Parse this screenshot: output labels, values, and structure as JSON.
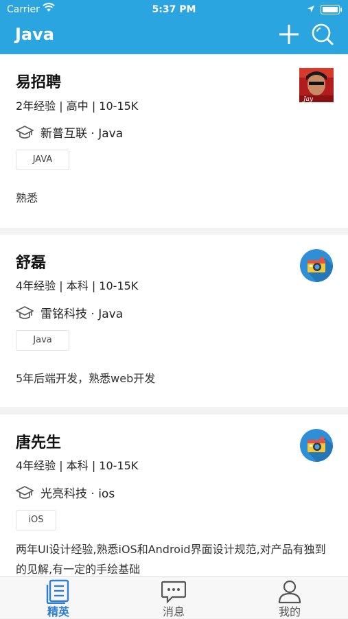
{
  "status": {
    "carrier": "Carrier",
    "time": "5:37 PM"
  },
  "nav": {
    "title": "Java"
  },
  "candidates": [
    {
      "name": "易招聘",
      "meta": "2年经验 | 高中 | 10-15K",
      "company": "新普互联 · Java",
      "tag": "JAVA",
      "desc": "熟悉",
      "avatar": "photo-avatar"
    },
    {
      "name": "舒磊",
      "meta": "4年经验 | 本科 | 10-15K",
      "company": "雷铭科技 · Java",
      "tag": "Java",
      "desc": "5年后端开发，熟悉web开发",
      "avatar": "camera-avatar"
    },
    {
      "name": "唐先生",
      "meta": "4年经验 | 本科 | 10-15K",
      "company": "光亮科技 · ios",
      "tag": "iOS",
      "desc": "两年UI设计经验,熟悉iOS和Android界面设计规范,对产品有独到的见解,有一定的手绘基础",
      "avatar": "camera-avatar"
    }
  ],
  "tabs": [
    {
      "label": "精英",
      "icon": "list-icon",
      "active": true
    },
    {
      "label": "消息",
      "icon": "message-icon",
      "active": false
    },
    {
      "label": "我的",
      "icon": "person-icon",
      "active": false
    }
  ],
  "colors": {
    "accent": "#2aa5e0",
    "tab_inactive": "#555555"
  }
}
